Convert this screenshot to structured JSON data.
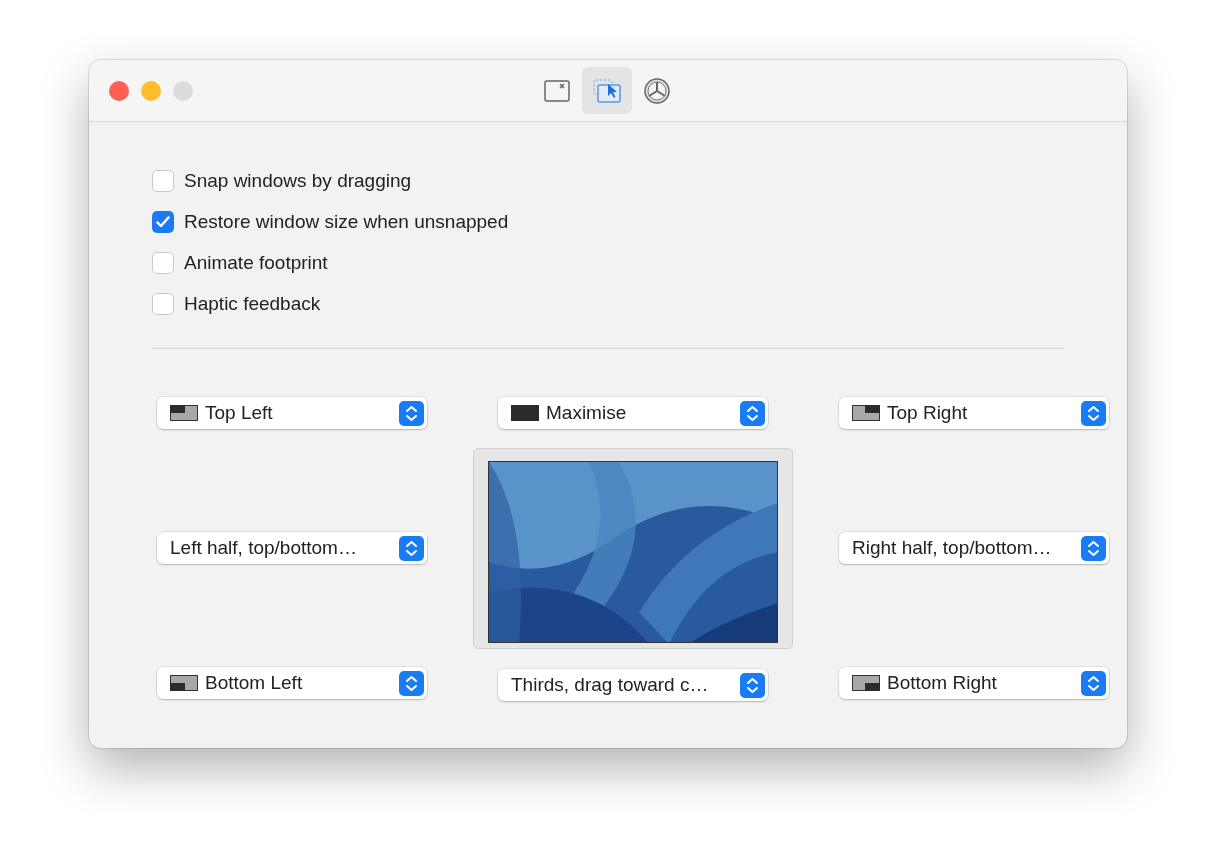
{
  "toolbar": [
    {
      "kind": "shortcuts",
      "selected": false
    },
    {
      "kind": "snap",
      "selected": true
    },
    {
      "kind": "general",
      "selected": false
    }
  ],
  "options": [
    {
      "label": "Snap windows by dragging",
      "checked": false
    },
    {
      "label": "Restore window size when unsnapped",
      "checked": true
    },
    {
      "label": "Animate footprint",
      "checked": false
    },
    {
      "label": "Haptic feedback",
      "checked": false
    }
  ],
  "left": [
    {
      "value": "Top Left",
      "kind": "topleft"
    },
    {
      "value": "Left half, top/bottom…",
      "kind": "plain"
    },
    {
      "value": "Bottom Left",
      "kind": "bottomleft"
    }
  ],
  "center": [
    {
      "value": "Maximise",
      "kind": "full"
    },
    {
      "value": "Thirds, drag toward c…",
      "kind": "plain"
    }
  ],
  "right": [
    {
      "value": "Top Right",
      "kind": "topright"
    },
    {
      "value": "Right half, top/bottom…",
      "kind": "plain"
    },
    {
      "value": "Bottom Right",
      "kind": "bottomright"
    }
  ]
}
